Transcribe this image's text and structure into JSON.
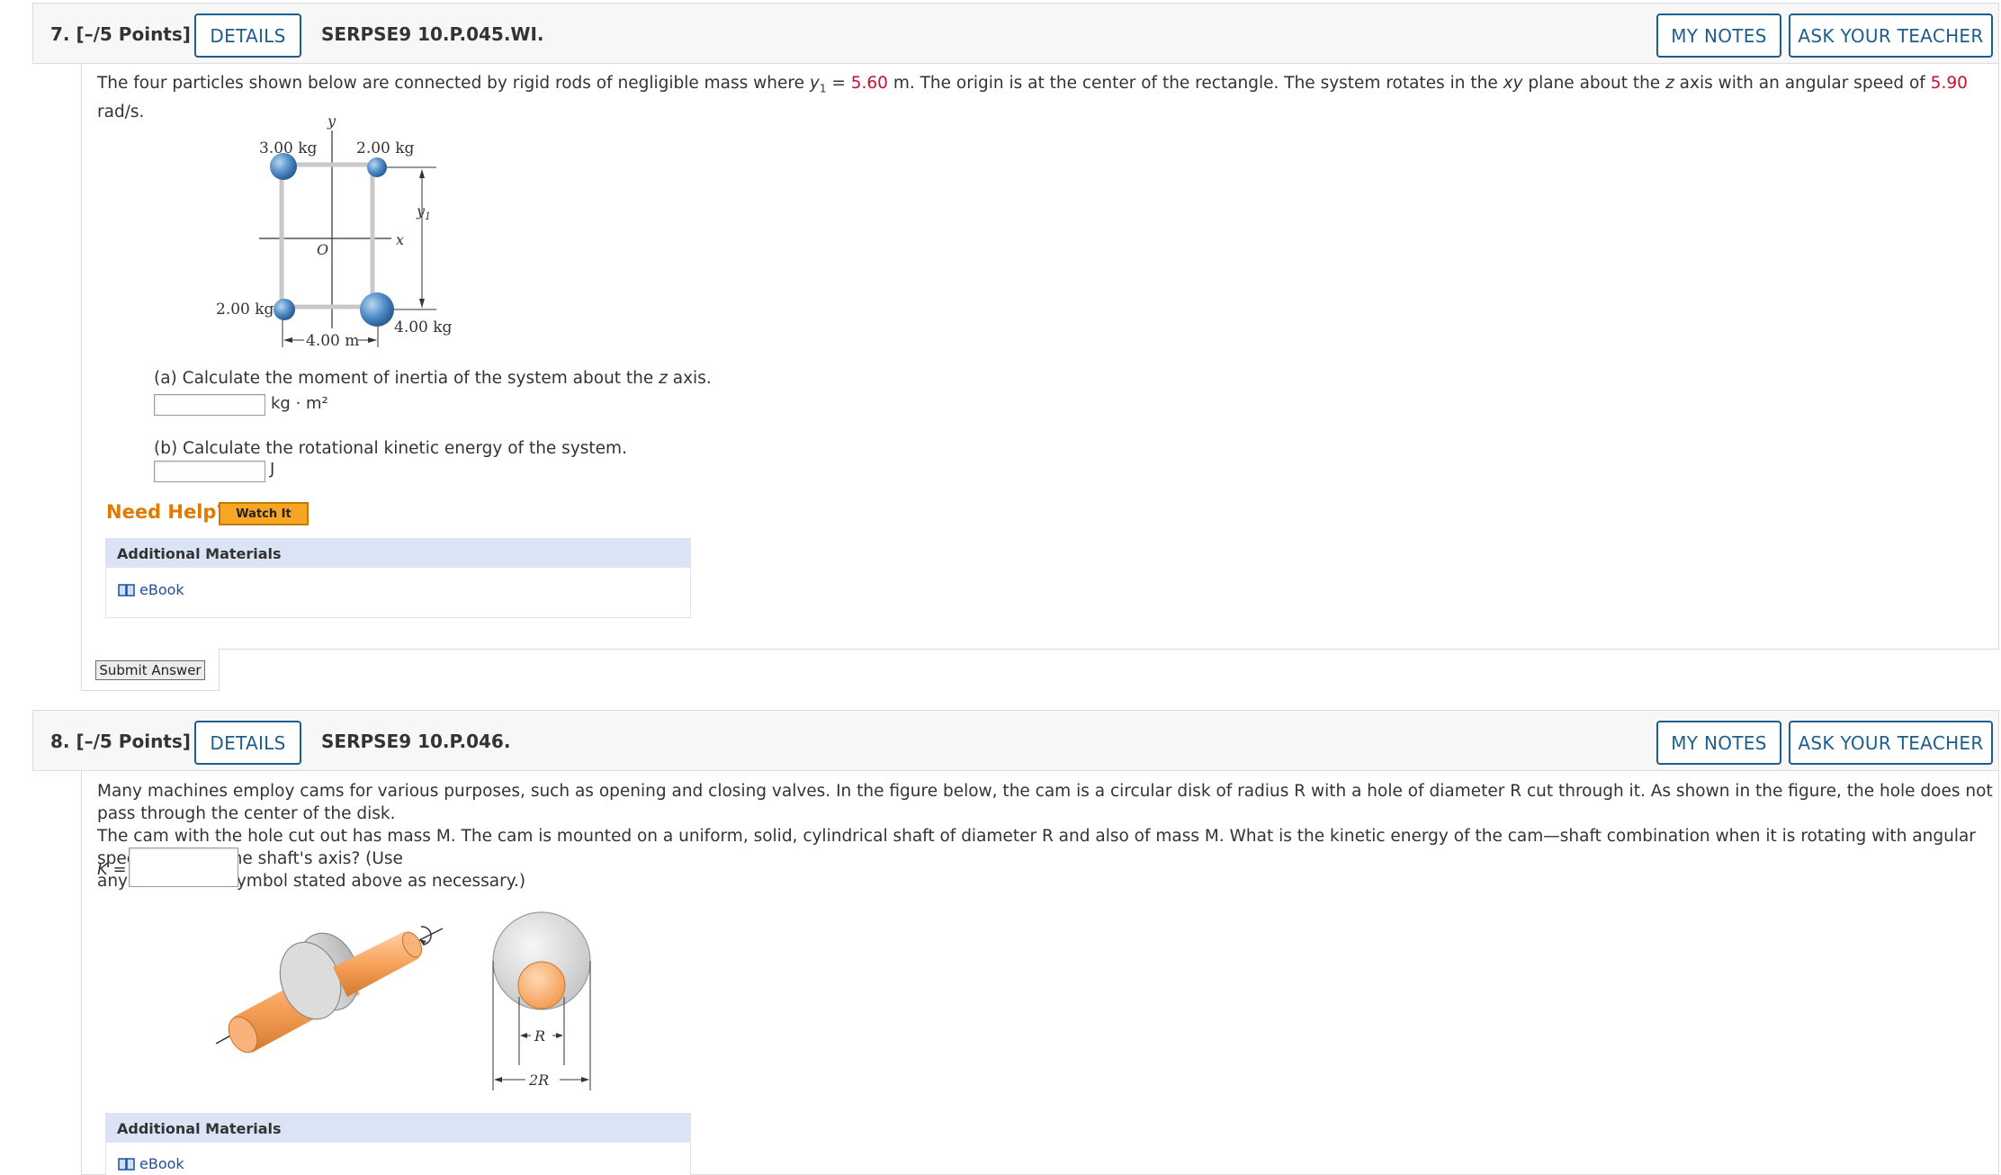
{
  "q7": {
    "number": "7.",
    "points": "[–/5 Points]",
    "details_label": "DETAILS",
    "code": "SERPSE9 10.P.045.WI.",
    "my_notes_label": "MY NOTES",
    "ask_teacher_label": "ASK YOUR TEACHER",
    "text_1": "The four particles shown below are connected by rigid rods of negligible mass where ",
    "y1_symbol": "y",
    "y1_sub": "1",
    "text_eq": " = ",
    "y1_value": "5.60",
    "text_2": " m. The origin is at the center of the rectangle. The system rotates in the ",
    "xy": "xy",
    "text_3": " plane about the ",
    "z": "z",
    "text_4": " axis with an angular speed of ",
    "omega_value": "5.90",
    "text_5": " rad/s.",
    "figure": {
      "mass_tl": "3.00 kg",
      "mass_tr": "2.00 kg",
      "mass_bl": "2.00 kg",
      "mass_br": "4.00 kg",
      "width_label": "4.00 m",
      "y_axis": "y",
      "x_axis": "x",
      "origin": "O",
      "y1_label": "y",
      "y1_label_sub": "1"
    },
    "part_a_prefix": "(a) Calculate the moment of inertia of the system about the ",
    "part_a_z": "z",
    "part_a_suffix": " axis.",
    "part_a_unit": "kg · m²",
    "part_a_value": "",
    "part_b": "(b) Calculate the rotational kinetic energy of the system.",
    "part_b_unit": "J",
    "part_b_value": "",
    "need_help": "Need Help?",
    "watch_it": "Watch It",
    "additional_materials": "Additional Materials",
    "ebook": "eBook",
    "submit": "Submit Answer"
  },
  "q8": {
    "number": "8.",
    "points": "[–/5 Points]",
    "details_label": "DETAILS",
    "code": "SERPSE9 10.P.046.",
    "my_notes_label": "MY NOTES",
    "ask_teacher_label": "ASK YOUR TEACHER",
    "line1": "Many machines employ cams for various purposes, such as opening and closing valves. In the figure below, the cam is a circular disk of radius R with a hole of diameter R cut through it. As shown in the figure, the hole does not pass through the center of the disk.",
    "line2": "The cam with the hole cut out has mass M. The cam is mounted on a uniform, solid, cylindrical shaft of diameter R and also of mass M. What is the kinetic energy of the cam—shaft combination when it is rotating with angular speed ω about the shaft's axis? (Use",
    "line3": "any variable or symbol stated above as necessary.)",
    "k_label": "K =",
    "k_value": "",
    "figure": {
      "r_label": "R",
      "two_r_label": "2R"
    },
    "additional_materials": "Additional Materials",
    "ebook": "eBook"
  },
  "colors": {
    "accent": "#1f5e8c",
    "given_value": "#c8102e",
    "need_help": "#e07a00",
    "watch_it": "#f6a623",
    "materials_header": "#dbe4f5"
  }
}
